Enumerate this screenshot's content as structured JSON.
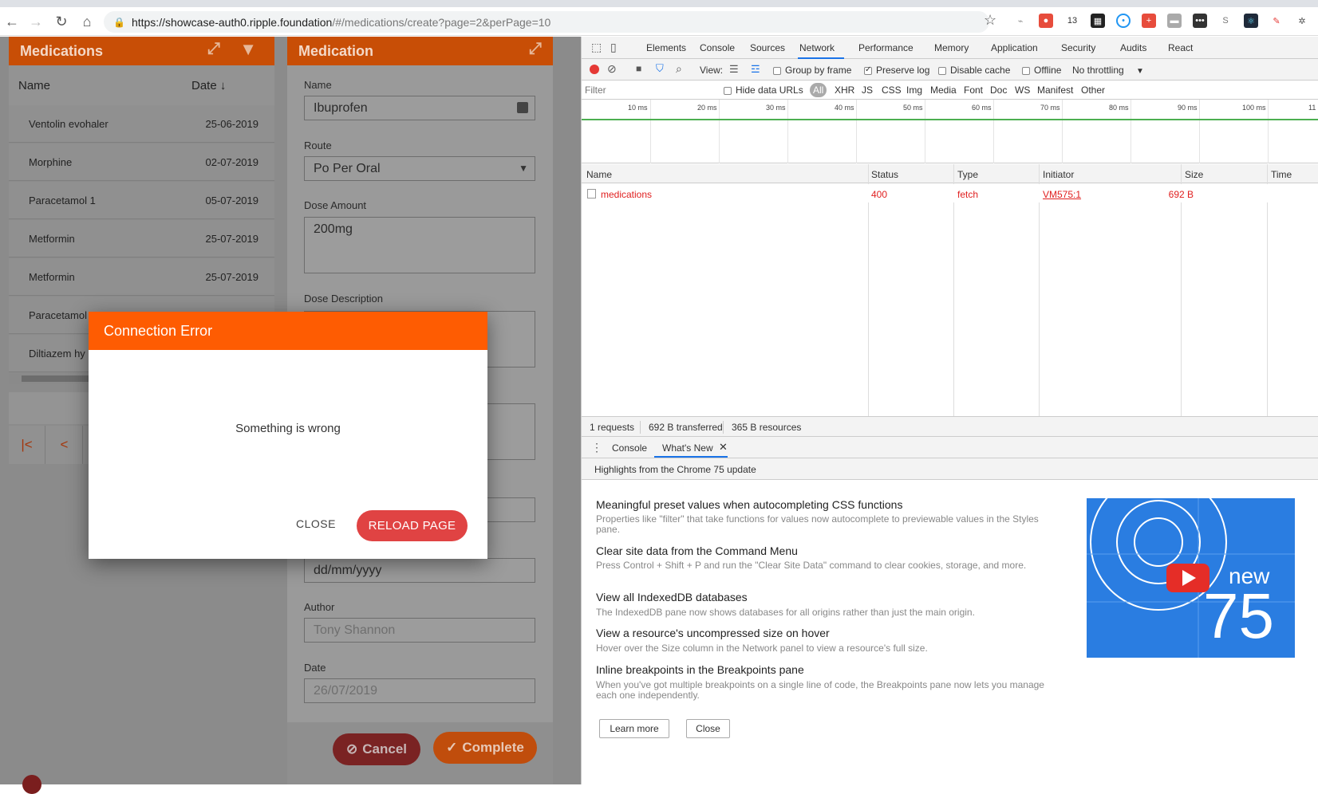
{
  "browser": {
    "url_host": "https://showcase-auth0.ripple.foundation",
    "url_path": "/#/medications/create?page=2&perPage=10",
    "nav": {
      "back": "←",
      "forward": "→",
      "reload": "↻",
      "home": "⌂"
    }
  },
  "medications_panel": {
    "title": "Medications",
    "col_name": "Name",
    "col_date": "Date ↓",
    "rows": [
      {
        "name": "Ventolin evohaler",
        "date": "25-06-2019"
      },
      {
        "name": "Morphine",
        "date": "02-07-2019"
      },
      {
        "name": "Paracetamol 1",
        "date": "05-07-2019"
      },
      {
        "name": "Metformin",
        "date": "25-07-2019"
      },
      {
        "name": "Metformin",
        "date": "25-07-2019"
      },
      {
        "name": "Paracetamol",
        "date": ""
      },
      {
        "name": "Diltiazem hy",
        "date": ""
      }
    ],
    "pager_first": "|<",
    "pager_prev": "<"
  },
  "medication_form": {
    "title": "Medication",
    "name_label": "Name",
    "name_value": "Ibuprofen",
    "route_label": "Route",
    "route_value": "Po Per Oral",
    "dose_amount_label": "Dose Amount",
    "dose_amount_value": "200mg",
    "dose_description_label": "Dose Description",
    "date_value": "dd/mm/yyyy",
    "author_label": "Author",
    "author_value": "Tony Shannon",
    "date_label": "Date",
    "date_created_value": "26/07/2019",
    "cancel_label": "Cancel",
    "complete_label": "Complete"
  },
  "dialog": {
    "title": "Connection Error",
    "message": "Something is wrong",
    "close_label": "CLOSE",
    "reload_label": "RELOAD PAGE"
  },
  "devtools": {
    "tabs": [
      "Elements",
      "Console",
      "Sources",
      "Network",
      "Performance",
      "Memory",
      "Application",
      "Security",
      "Audits",
      "React"
    ],
    "active_tab": "Network",
    "toolbar": {
      "view_label": "View:",
      "group_by_frame": "Group by frame",
      "preserve_log": "Preserve log",
      "disable_cache": "Disable cache",
      "offline": "Offline",
      "throttling": "No throttling"
    },
    "filter_placeholder": "Filter",
    "hide_data_urls": "Hide data URLs",
    "type_filters": [
      "All",
      "XHR",
      "JS",
      "CSS",
      "Img",
      "Media",
      "Font",
      "Doc",
      "WS",
      "Manifest",
      "Other"
    ],
    "timeline_ticks": [
      "10 ms",
      "20 ms",
      "30 ms",
      "40 ms",
      "50 ms",
      "60 ms",
      "70 ms",
      "80 ms",
      "90 ms",
      "100 ms",
      "11"
    ],
    "columns": [
      "Name",
      "Status",
      "Type",
      "Initiator",
      "Size",
      "Time"
    ],
    "request": {
      "name": "medications",
      "status": "400",
      "type": "fetch",
      "initiator": "VM575:1",
      "size": "692 B"
    },
    "summary": [
      "1 requests",
      "692 B transferred",
      "365 B resources"
    ],
    "drawer_tabs": [
      "Console",
      "What's New"
    ],
    "whats_new_header": "Highlights from the Chrome 75 update",
    "items": [
      {
        "title": "Meaningful preset values when autocompleting CSS functions",
        "desc": "Properties like \"filter\" that take functions for values now autocomplete to previewable values in the Styles pane."
      },
      {
        "title": "Clear site data from the Command Menu",
        "desc": "Press Control + Shift + P and run the \"Clear Site Data\" command to clear cookies, storage, and more."
      },
      {
        "title": "View all IndexedDB databases",
        "desc": "The IndexedDB pane now shows databases for all origins rather than just the main origin."
      },
      {
        "title": "View a resource's uncompressed size on hover",
        "desc": "Hover over the Size column in the Network panel to view a resource's full size."
      },
      {
        "title": "Inline breakpoints in the Breakpoints pane",
        "desc": "When you've got multiple breakpoints on a single line of code, the Breakpoints pane now lets you manage each one independently."
      }
    ],
    "learn_more": "Learn more",
    "close": "Close",
    "video_new": "new",
    "video_version": "75"
  }
}
